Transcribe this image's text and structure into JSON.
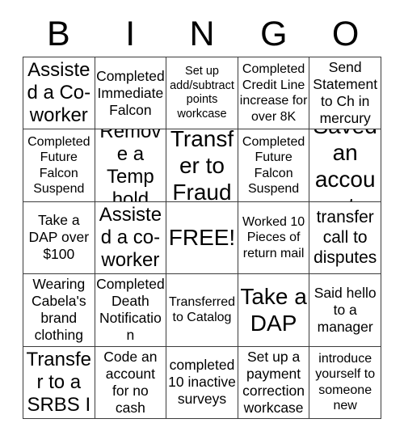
{
  "card": {
    "type": "bingo-card",
    "header_letters": [
      "B",
      "I",
      "N",
      "G",
      "O"
    ],
    "columns": 5,
    "rows": 5,
    "border_color": "#3c3c3c",
    "background_color": "#ffffff",
    "text_color": "#000000",
    "free_space": {
      "row": 3,
      "column": 3,
      "label": "FREE!"
    },
    "cells": [
      [
        {
          "text": "Assisted a Co-worker",
          "size": "xl"
        },
        {
          "text": "Completed Immediate Falcon",
          "size": "m"
        },
        {
          "text": "Set up add/subtract points workcase",
          "size": "xs"
        },
        {
          "text": "Completed Credit Line increase for over 8K",
          "size": "s"
        },
        {
          "text": "Send Statement to Ch in mercury",
          "size": "m"
        }
      ],
      [
        {
          "text": "Completed Future Falcon Suspend",
          "size": "s"
        },
        {
          "text": "Remove a Temp hold",
          "size": "xl"
        },
        {
          "text": "Transfer to Fraud",
          "size": "xxl"
        },
        {
          "text": "Completed Future Falcon Suspend",
          "size": "s"
        },
        {
          "text": "Saved an account",
          "size": "xxl"
        }
      ],
      [
        {
          "text": "Take a DAP over $100",
          "size": "m"
        },
        {
          "text": "Assisted a co-worker",
          "size": "xl"
        },
        {
          "text": "FREE!",
          "size": "free"
        },
        {
          "text": "Worked 10 Pieces of return mail",
          "size": "s"
        },
        {
          "text": "transfer call to disputes",
          "size": "l"
        }
      ],
      [
        {
          "text": "Wearing Cabela's brand clothing",
          "size": "m"
        },
        {
          "text": "Completed Death Notification",
          "size": "m"
        },
        {
          "text": "Transferred to Catalog",
          "size": "s"
        },
        {
          "text": "Take a DAP",
          "size": "xxl"
        },
        {
          "text": "Said hello to a manager",
          "size": "m"
        }
      ],
      [
        {
          "text": "Transfer to a SRBS I",
          "size": "xl"
        },
        {
          "text": "Code an account for no cash",
          "size": "m"
        },
        {
          "text": "completed 10 inactive surveys",
          "size": "m"
        },
        {
          "text": "Set up a payment correction workcase",
          "size": "m"
        },
        {
          "text": "introduce yourself to someone new",
          "size": "s"
        }
      ]
    ]
  }
}
